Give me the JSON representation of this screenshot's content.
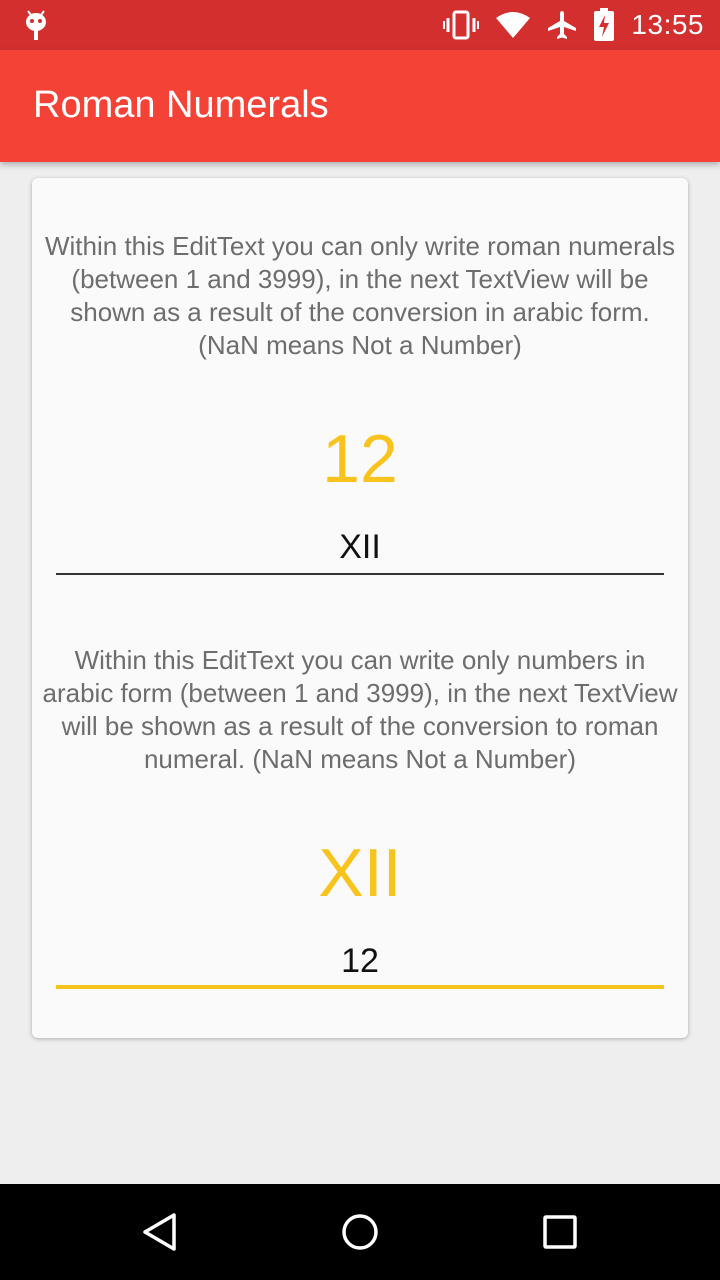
{
  "status_bar": {
    "time": "13:55",
    "icons": [
      "android-debug-icon",
      "vibrate-icon",
      "wifi-icon",
      "airplane-icon",
      "battery-charging-icon"
    ]
  },
  "app_bar": {
    "title": "Roman Numerals"
  },
  "roman_section": {
    "description": "Within this EditText you can only write roman numerals (between 1 and 3999), in the next TextView will be shown as a result of the conversion in arabic form. (NaN means Not a Number)",
    "result": "12",
    "input_value": "XII"
  },
  "arabic_section": {
    "description": "Within this EditText you can write only numbers in arabic form (between 1 and 3999), in the next TextView will be shown as a result of the conversion to roman numeral. (NaN means Not a Number)",
    "result": "XII",
    "input_value": "12"
  },
  "colors": {
    "status_bar": "#d32f2f",
    "app_bar": "#f44336",
    "accent": "#f9c31d",
    "background": "#eeeeee",
    "card": "#fafafa"
  },
  "nav_bar": {
    "icons": [
      "back-icon",
      "home-icon",
      "recents-icon"
    ]
  }
}
